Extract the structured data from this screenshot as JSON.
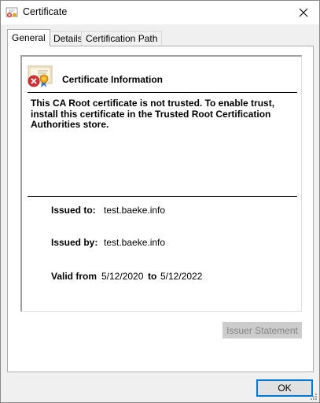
{
  "window": {
    "title": "Certificate",
    "icons": {
      "title": "certificate-icon",
      "close": "close-icon"
    }
  },
  "tabs": [
    {
      "label": "General",
      "active": true
    },
    {
      "label": "Details",
      "active": false
    },
    {
      "label": "Certification Path",
      "active": false
    }
  ],
  "general": {
    "heading": "Certificate Information",
    "icon": "certificate-untrusted-icon",
    "warning": "This CA Root certificate is not trusted. To enable trust, install this certificate in the Trusted Root Certification Authorities store.",
    "issued_to_label": "Issued to:",
    "issued_to": "test.baeke.info",
    "issued_by_label": "Issued by:",
    "issued_by": "test.baeke.info",
    "valid_from_label": "Valid from",
    "valid_from": "5/12/2020",
    "to_label": "to",
    "valid_to": "5/12/2022"
  },
  "buttons": {
    "issuer_statement": "Issuer Statement",
    "issuer_statement_enabled": false,
    "ok": "OK"
  },
  "colors": {
    "focus_border": "#0078d7",
    "disabled_text": "#838383",
    "error_red": "#d13438"
  }
}
